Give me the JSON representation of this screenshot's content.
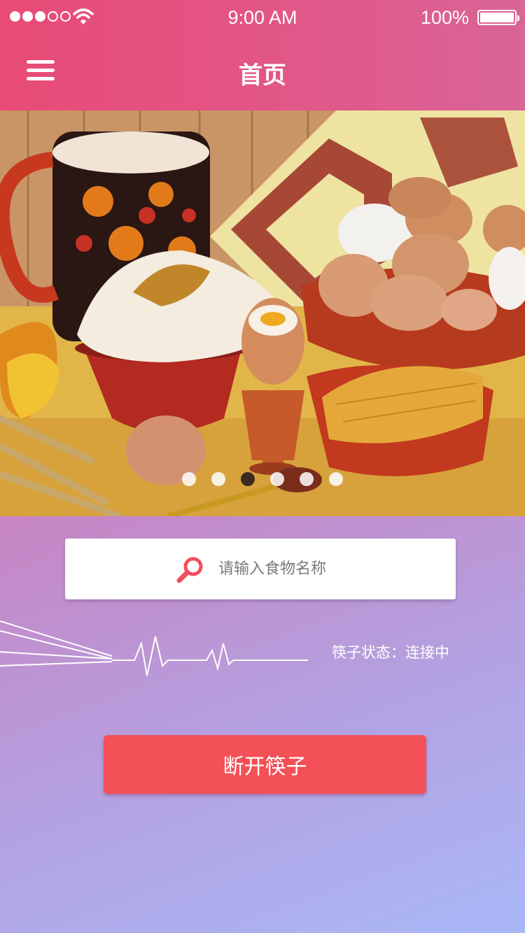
{
  "status_bar": {
    "time": "9:00 AM",
    "battery_percent": "100%",
    "signal_bars_filled": 3,
    "signal_bars_total": 5,
    "wifi_icon": "wifi-icon"
  },
  "header": {
    "title": "首页",
    "menu_icon": "hamburger-menu-icon"
  },
  "banner": {
    "image_description": "food-photo",
    "page_count": 6,
    "active_index": 2
  },
  "search": {
    "placeholder": "请输入食物名称",
    "icon": "search-icon",
    "icon_color": "#f04e5c"
  },
  "chopstick": {
    "status_text": "筷子状态：连接中"
  },
  "actions": {
    "disconnect_label": "断开筷子",
    "button_color": "#f35057"
  },
  "colors": {
    "header": "#e84b76",
    "background_top": "#d9609a",
    "background_bottom": "#a9b7f7"
  }
}
